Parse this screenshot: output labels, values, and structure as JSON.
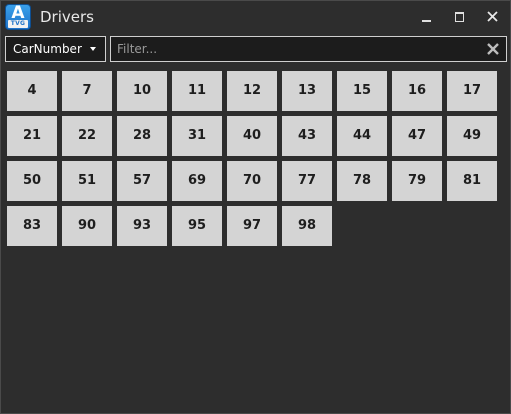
{
  "window": {
    "title": "Drivers",
    "app_icon": {
      "letter": "A",
      "sub": "TVG"
    },
    "controls": [
      "minimize-icon",
      "maximize-icon",
      "close-icon"
    ]
  },
  "toolbar": {
    "sort_field": {
      "selected": "CarNumber"
    },
    "filter": {
      "placeholder": "Filter...",
      "value": ""
    },
    "clear_icon": "close-icon"
  },
  "drivers": [
    {
      "label": "4"
    },
    {
      "label": "7"
    },
    {
      "label": "10"
    },
    {
      "label": "11"
    },
    {
      "label": "12"
    },
    {
      "label": "13"
    },
    {
      "label": "15"
    },
    {
      "label": "16"
    },
    {
      "label": "17"
    },
    {
      "label": "21"
    },
    {
      "label": "22"
    },
    {
      "label": "28"
    },
    {
      "label": "31"
    },
    {
      "label": "40"
    },
    {
      "label": "43"
    },
    {
      "label": "44"
    },
    {
      "label": "47"
    },
    {
      "label": "49"
    },
    {
      "label": "50"
    },
    {
      "label": "51"
    },
    {
      "label": "57"
    },
    {
      "label": "69"
    },
    {
      "label": "70"
    },
    {
      "label": "77"
    },
    {
      "label": "78"
    },
    {
      "label": "79"
    },
    {
      "label": "81"
    },
    {
      "label": "83"
    },
    {
      "label": "90"
    },
    {
      "label": "93"
    },
    {
      "label": "95"
    },
    {
      "label": "97"
    },
    {
      "label": "98"
    }
  ],
  "colors": {
    "background": "#2d2d2d",
    "tile": "#d4d4d4",
    "tile_text": "#1e1e1e",
    "accent": "#1f73c9"
  }
}
